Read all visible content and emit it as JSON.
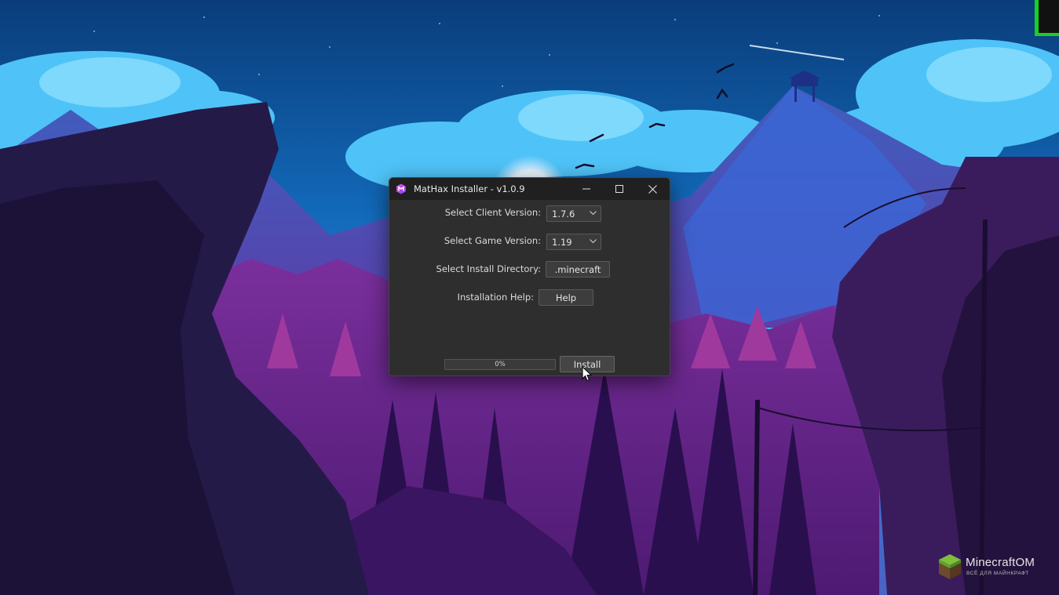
{
  "window": {
    "title": "MatHax Installer - v1.0.9",
    "app_icon": "mathax-logo-icon",
    "controls": [
      "minimize-icon",
      "maximize-icon",
      "close-icon"
    ]
  },
  "form": {
    "client_version_label": "Select Client Version:",
    "client_version_value": "1.7.6",
    "game_version_label": "Select Game Version:",
    "game_version_value": "1.19",
    "install_dir_label": "Select Install Directory:",
    "install_dir_button": ".minecraft",
    "help_label": "Installation Help:",
    "help_button": "Help"
  },
  "install": {
    "progress_text": "0%",
    "progress_value": 0,
    "install_button": "Install"
  },
  "watermark": {
    "name": "MinecraftOM",
    "subtitle": "ВСЁ ДЛЯ МАЙНКРАФТ"
  },
  "colors": {
    "accent_green": "#19d020",
    "window_bg": "#2e2e2e",
    "titlebar_bg": "#202020"
  }
}
